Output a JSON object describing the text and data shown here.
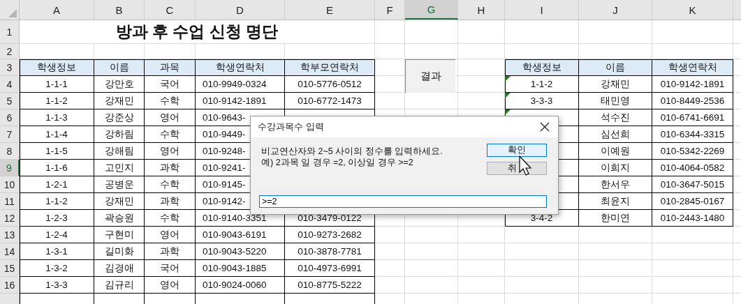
{
  "columns": [
    {
      "label": "A",
      "selected": false
    },
    {
      "label": "B",
      "selected": false
    },
    {
      "label": "C",
      "selected": false
    },
    {
      "label": "D",
      "selected": false
    },
    {
      "label": "E",
      "selected": false
    },
    {
      "label": "F",
      "selected": false
    },
    {
      "label": "G",
      "selected": true
    },
    {
      "label": "H",
      "selected": false
    },
    {
      "label": "I",
      "selected": false
    },
    {
      "label": "J",
      "selected": false
    },
    {
      "label": "K",
      "selected": false
    }
  ],
  "row_headers": [
    {
      "label": "1",
      "selected": false
    },
    {
      "label": "2",
      "selected": false
    },
    {
      "label": "3",
      "selected": false
    },
    {
      "label": "4",
      "selected": false
    },
    {
      "label": "5",
      "selected": false
    },
    {
      "label": "6",
      "selected": false
    },
    {
      "label": "7",
      "selected": false
    },
    {
      "label": "8",
      "selected": false
    },
    {
      "label": "9",
      "selected": true
    },
    {
      "label": "10",
      "selected": false
    },
    {
      "label": "11",
      "selected": false
    },
    {
      "label": "12",
      "selected": false
    },
    {
      "label": "13",
      "selected": false
    },
    {
      "label": "14",
      "selected": false
    },
    {
      "label": "15",
      "selected": false
    },
    {
      "label": "16",
      "selected": false
    }
  ],
  "title": "방과 후 수업 신청 명단",
  "left_table": {
    "headers": [
      "학생정보",
      "이름",
      "과목",
      "학생연락처",
      "학부모연락처"
    ],
    "rows": [
      {
        "info": "1-1-1",
        "name": "강만호",
        "subject": "국어",
        "student_phone": "010-9949-0324",
        "parent_phone": "010-5776-0512"
      },
      {
        "info": "1-1-2",
        "name": "강재민",
        "subject": "수학",
        "student_phone": "010-9142-1891",
        "parent_phone": "010-6772-1473"
      },
      {
        "info": "1-1-3",
        "name": "강준상",
        "subject": "영어",
        "student_phone": "010-9643-"
      },
      {
        "info": "1-1-4",
        "name": "강하림",
        "subject": "수학",
        "student_phone": "010-9449-"
      },
      {
        "info": "1-1-5",
        "name": "강해림",
        "subject": "영어",
        "student_phone": "010-9248-"
      },
      {
        "info": "1-1-6",
        "name": "고민지",
        "subject": "과학",
        "student_phone": "010-9241-"
      },
      {
        "info": "1-2-1",
        "name": "공병운",
        "subject": "수학",
        "student_phone": "010-9145-"
      },
      {
        "info": "1-1-2",
        "name": "강재민",
        "subject": "과학",
        "student_phone": "010-9142-"
      },
      {
        "info": "1-2-3",
        "name": "곽승원",
        "subject": "수학",
        "student_phone": "010-9140-3351",
        "parent_phone": "010-3479-0122"
      },
      {
        "info": "1-2-4",
        "name": "구현미",
        "subject": "영어",
        "student_phone": "010-9043-6191",
        "parent_phone": "010-9273-2682"
      },
      {
        "info": "1-3-1",
        "name": "길미화",
        "subject": "과학",
        "student_phone": "010-9043-5220",
        "parent_phone": "010-3878-7781"
      },
      {
        "info": "1-3-2",
        "name": "김경애",
        "subject": "국어",
        "student_phone": "010-9043-1885",
        "parent_phone": "010-4973-6991"
      },
      {
        "info": "1-3-3",
        "name": "김규리",
        "subject": "영어",
        "student_phone": "010-9024-0060",
        "parent_phone": "010-8775-5222"
      }
    ]
  },
  "result_button": {
    "label": "결과"
  },
  "right_table": {
    "headers": [
      "학생정보",
      "이름",
      "학생연락처"
    ],
    "rows": [
      {
        "info": "1-1-2",
        "name": "강재민",
        "phone": "010-9142-1891",
        "flagged": true
      },
      {
        "info": "3-3-3",
        "name": "태민영",
        "phone": "010-8449-2536",
        "flagged": true
      },
      {
        "name": "석수진",
        "phone": "010-6741-6691",
        "flagged": true
      },
      {
        "name": "심선희",
        "phone": "010-6344-3315",
        "flagged": false
      },
      {
        "name": "이예원",
        "phone": "010-5342-2269",
        "flagged": false
      },
      {
        "name": "이희지",
        "phone": "010-4064-0582",
        "flagged": false
      },
      {
        "name": "한서우",
        "phone": "010-3647-5015",
        "flagged": false
      },
      {
        "name": "최윤지",
        "phone": "010-2845-0167",
        "flagged": false
      },
      {
        "info": "3-4-2",
        "name": "한미연",
        "phone": "010-2443-1480",
        "flagged": false
      }
    ]
  },
  "dialog": {
    "title": "수강과목수 입력",
    "message_lines": [
      "비교연산자와 2~5 사이의 정수를 입력하세요.",
      "예) 2과목 일 경우 =2, 이상일 경우 >=2"
    ],
    "buttons": [
      {
        "label": "확인",
        "default": true
      },
      {
        "label": "취",
        "default": false
      }
    ],
    "input": {
      "value": ">=2"
    }
  }
}
